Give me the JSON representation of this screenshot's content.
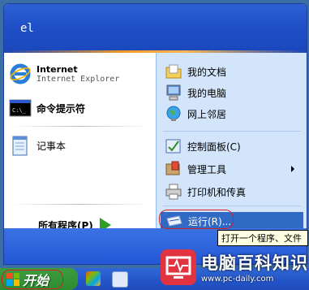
{
  "user": {
    "name": "el"
  },
  "pinned": [
    {
      "title": "Internet",
      "subtitle": "Internet Explorer",
      "icon": "internet-explorer-icon"
    },
    {
      "title": "命令提示符",
      "icon": "command-prompt-icon"
    }
  ],
  "recent": [
    {
      "label": "记事本",
      "icon": "notepad-icon"
    }
  ],
  "all_programs": {
    "label": "所有程序(P)"
  },
  "places": [
    {
      "label": "我的文档",
      "icon": "my-documents-icon"
    },
    {
      "label": "我的电脑",
      "icon": "my-computer-icon"
    },
    {
      "label": "网上邻居",
      "icon": "network-places-icon"
    }
  ],
  "system": [
    {
      "label": "控制面板(C)",
      "icon": "control-panel-icon"
    },
    {
      "label": "管理工具",
      "icon": "admin-tools-icon",
      "submenu": true
    },
    {
      "label": "打印机和传真",
      "icon": "printers-icon"
    }
  ],
  "run": {
    "label": "运行(R)...",
    "icon": "run-icon"
  },
  "tooltip": {
    "text": "打开一个程序、文件"
  },
  "taskbar": {
    "start_label": "开始"
  },
  "watermark": {
    "title": "电脑百科知识",
    "url": "www.pc-daily.com"
  },
  "colors": {
    "header": "#1f50c9",
    "highlight": "#316ac5",
    "start_green": "#2f8b31",
    "annotation_red": "#d42020"
  }
}
